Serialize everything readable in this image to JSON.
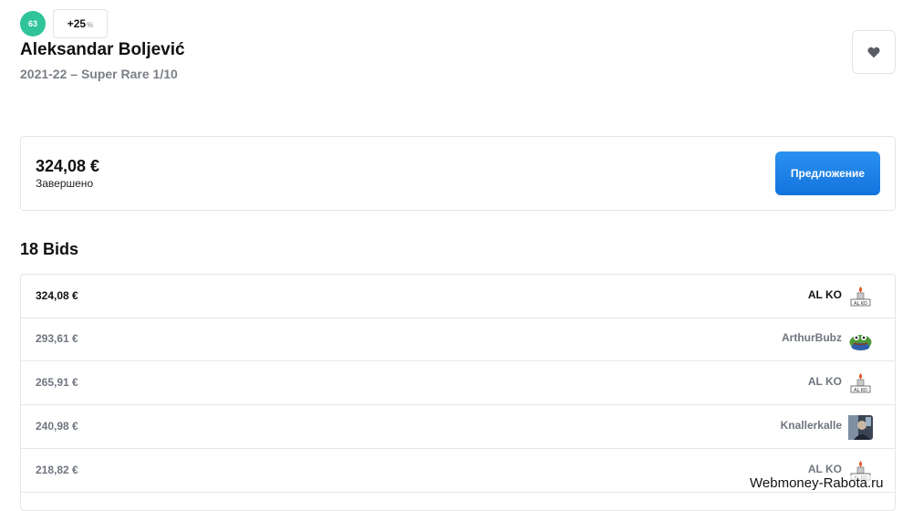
{
  "card": {
    "score": "63",
    "bonus": "+25",
    "bonus_unit": "%",
    "player_name": "Aleksandar Boljević",
    "subtitle": "2021-22 – Super Rare 1/10"
  },
  "favorite_icon": "heart-icon",
  "price_panel": {
    "price": "324,08 €",
    "status": "Завершено",
    "offer_button_label": "Предложение"
  },
  "bids_heading": "18 Bids",
  "bids": [
    {
      "amount": "324,08 €",
      "bidder": "AL KO",
      "avatar": "alko-crest-avatar"
    },
    {
      "amount": "293,61 €",
      "bidder": "ArthurBubz",
      "avatar": "frog-avatar"
    },
    {
      "amount": "265,91 €",
      "bidder": "AL KO",
      "avatar": "alko-crest-avatar"
    },
    {
      "amount": "240,98 €",
      "bidder": "Knallerkalle",
      "avatar": "photo-avatar"
    },
    {
      "amount": "218,82 €",
      "bidder": "AL KO",
      "avatar": "alko-crest-avatar"
    }
  ],
  "watermark": "Webmoney-Rabota.ru",
  "colors": {
    "score_badge": "#2fc49a",
    "offer_button": "#1a80e8",
    "muted_text": "#707580",
    "border": "#e6e6e6"
  }
}
